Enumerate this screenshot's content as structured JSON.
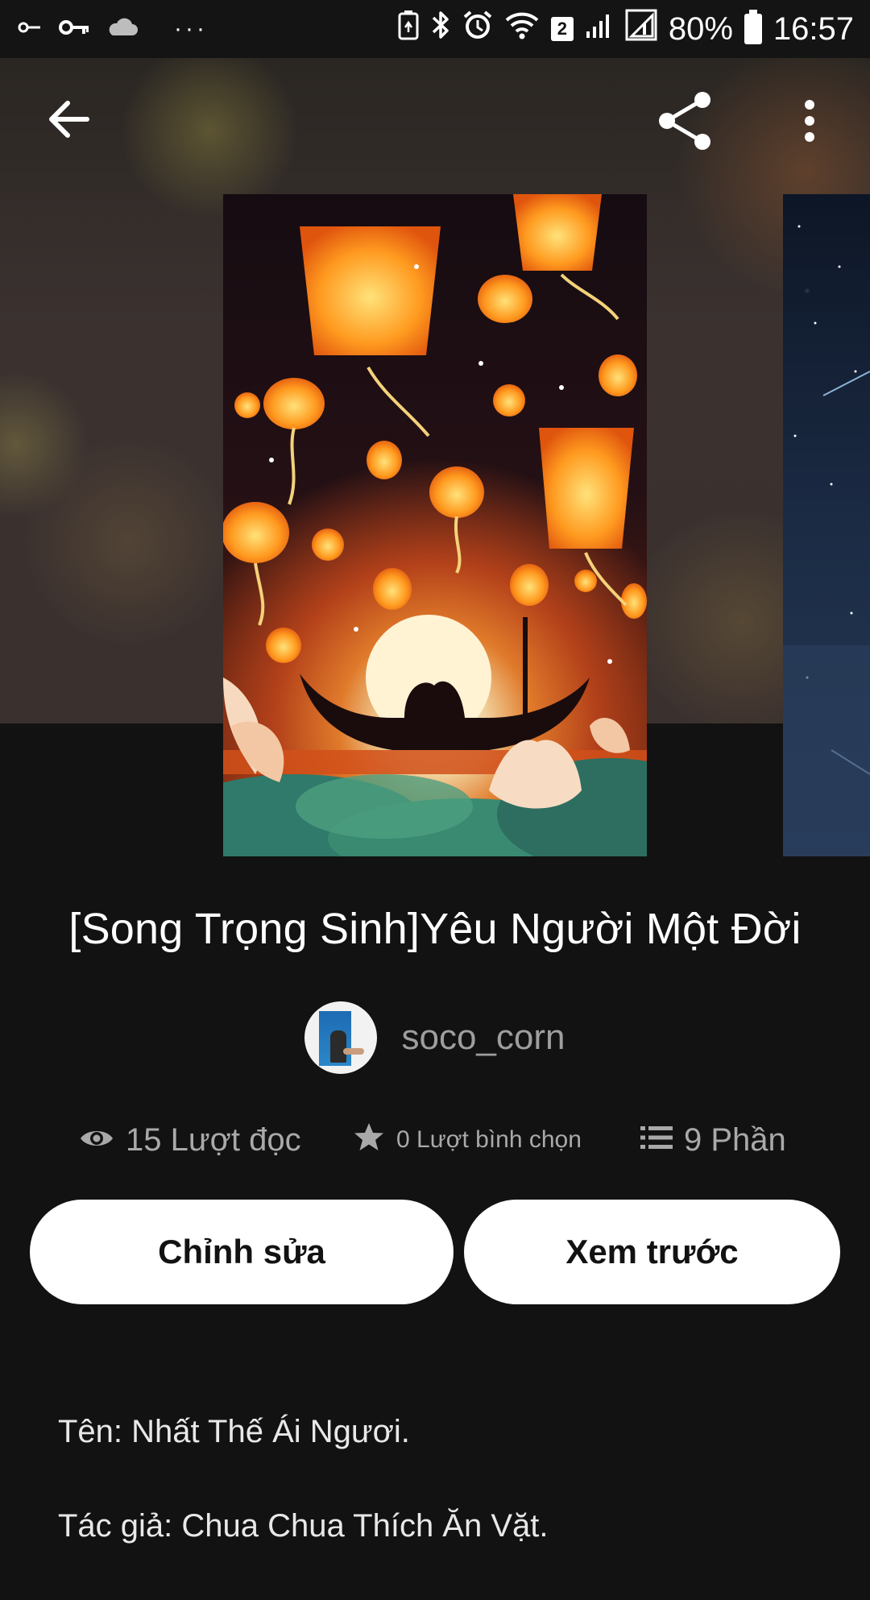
{
  "status_bar": {
    "battery": "80%",
    "time": "16:57",
    "sim_badge": "2",
    "more": "···",
    "icons": [
      "key-icon",
      "vpn-key-icon",
      "cloud-icon",
      "more-dots-icon",
      "battery-saver-icon",
      "bluetooth-icon",
      "alarm-icon",
      "wifi-icon",
      "sim-2-icon",
      "signal-icon",
      "signal-2-icon",
      "battery-icon"
    ]
  },
  "appbar": {
    "back_icon": "arrow-left-icon",
    "share_icon": "share-icon",
    "menu_icon": "more-vertical-icon"
  },
  "story": {
    "title": "[Song Trọng Sinh]Yêu Người Một Đời",
    "author": "soco_corn"
  },
  "stats": {
    "reads": "15 Lượt đọc",
    "votes": "0 Lượt bình chọn",
    "parts": "9 Phần"
  },
  "actions": {
    "edit": "Chỉnh sửa",
    "preview": "Xem trước"
  },
  "description": {
    "line1": "Tên: Nhất Thế Ái Ngươi.",
    "line2": "Tác giả: Chua Chua Thích Ăn Vặt."
  },
  "colors": {
    "background": "#121212",
    "button_bg": "#ffffff",
    "button_text": "#121212",
    "muted_text": "#a9a9a9"
  }
}
